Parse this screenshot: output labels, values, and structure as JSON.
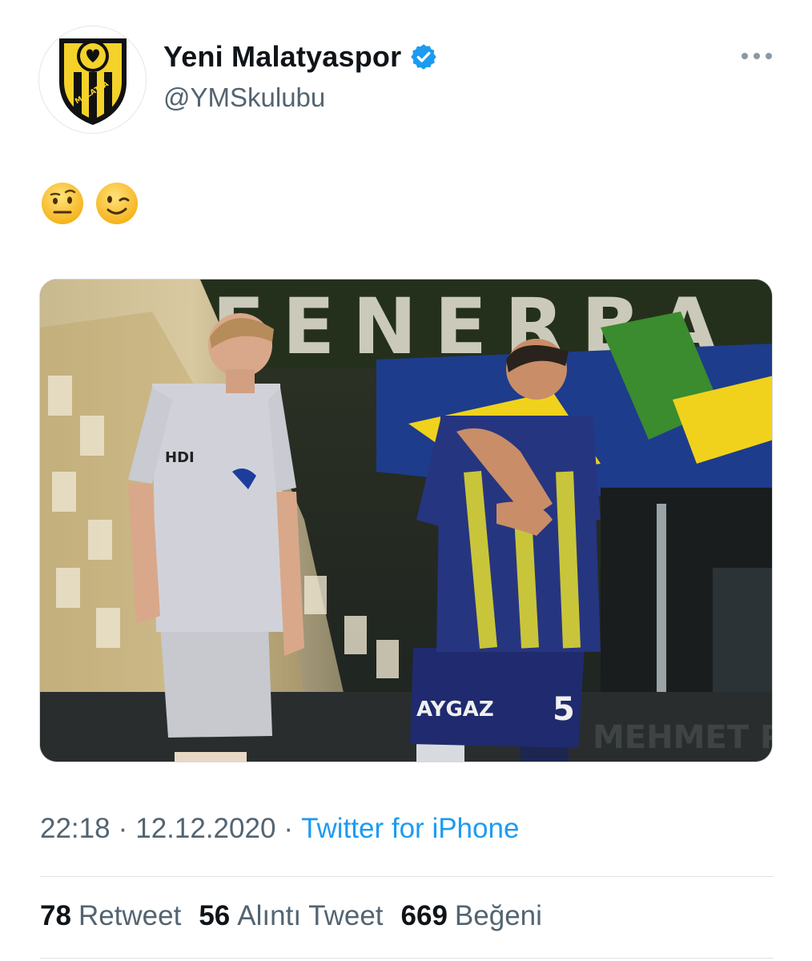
{
  "author": {
    "display_name": "Yeni Malatyaspor",
    "handle": "@YMSkulubu",
    "verified": true,
    "logo_text": "MALATYA"
  },
  "tweet": {
    "emojis": [
      "raised-eyebrow-face",
      "winking-face"
    ]
  },
  "media": {
    "banner_text": "FENERBA",
    "left_player_sponsor": "HDI",
    "right_player_sponsor": "AYGAZ",
    "right_player_number": "5",
    "board_text": "MEHMET PAC"
  },
  "meta": {
    "time": "22:18",
    "separator": "·",
    "date": "12.12.2020",
    "source": "Twitter for iPhone"
  },
  "stats": {
    "retweets_count": "78",
    "retweets_label": "Retweet",
    "quotes_count": "56",
    "quotes_label": "Alıntı Tweet",
    "likes_count": "669",
    "likes_label": "Beğeni"
  },
  "colors": {
    "accent": "#1d9bf0",
    "secondary_text": "#536471",
    "club_yellow": "#f4d22a",
    "club_black": "#111111"
  }
}
